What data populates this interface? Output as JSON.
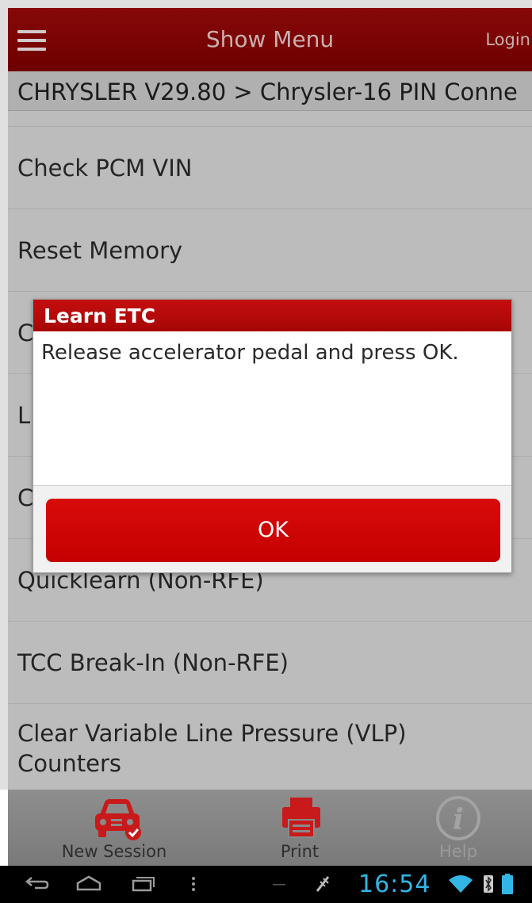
{
  "header": {
    "title": "Show Menu",
    "login_label": "Login"
  },
  "breadcrumb": "CHRYSLER V29.80 > Chrysler-16 PIN Conne",
  "menu": {
    "items": [
      {
        "label": "Check PCM VIN"
      },
      {
        "label": "Reset Memory"
      },
      {
        "label": "C"
      },
      {
        "label": "L"
      },
      {
        "label": "C"
      },
      {
        "label": "Quicklearn (Non-RFE)"
      },
      {
        "label": "TCC Break-In (Non-RFE)"
      },
      {
        "label": "Clear Variable Line Pressure (VLP) Counters"
      }
    ]
  },
  "dialog": {
    "title": "Learn ETC",
    "message": "Release accelerator pedal and press OK.",
    "ok_label": "OK"
  },
  "toolbar": {
    "new_session_label": "New Session",
    "print_label": "Print",
    "help_label": "Help"
  },
  "system_bar": {
    "time": "16:54"
  },
  "colors": {
    "header_red": "#8b0000",
    "dialog_title_red": "#b80a0a",
    "ok_button_red": "#cf0000",
    "clock_blue": "#33b5e5"
  }
}
